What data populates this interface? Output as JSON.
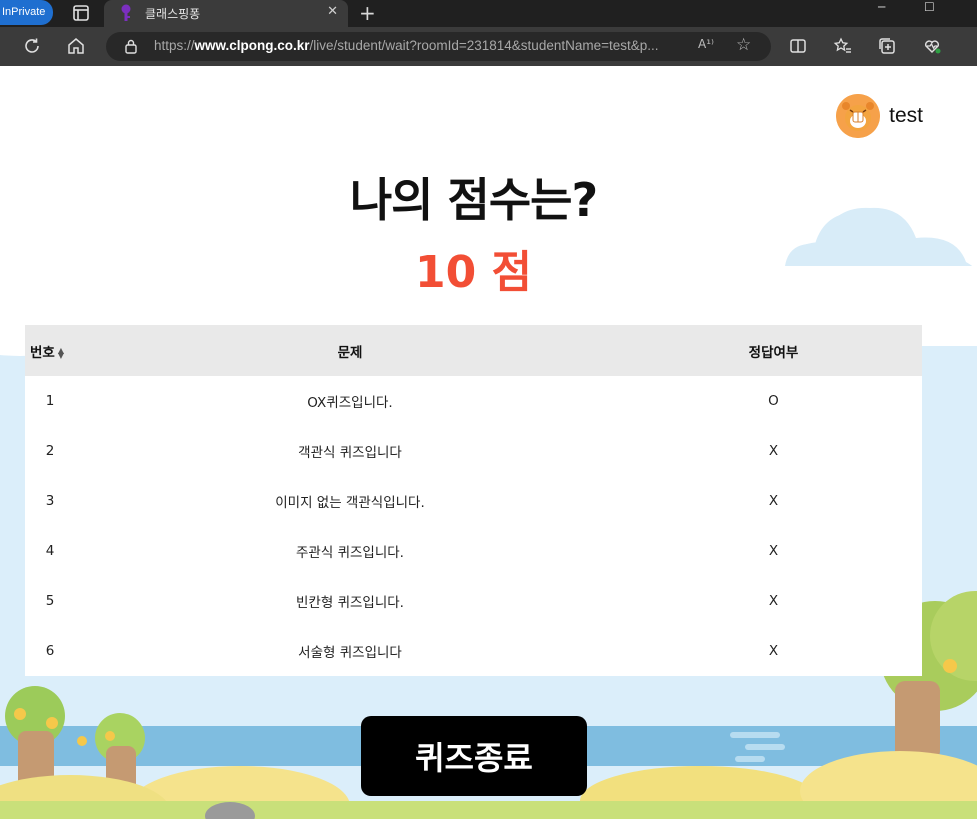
{
  "browser": {
    "inprivate_label": "InPrivate",
    "tab_title": "클래스핑퐁",
    "url_prefix": "https://",
    "url_domain": "www.clpong.co.kr",
    "url_rest": "/live/student/wait?roomId=231814&studentName=test&p...",
    "read_aloud": "A¹⁾",
    "icons": [
      "window-icon",
      "key-icon",
      "close-icon",
      "plus-icon",
      "minimize-icon",
      "maximize-icon",
      "refresh-icon",
      "home-icon",
      "lock-icon",
      "read-aloud-icon",
      "star-icon",
      "split-screen-icon",
      "favorites-icon",
      "collections-icon",
      "browser-essentials-icon"
    ]
  },
  "user": {
    "name": "test",
    "avatar_icon": "tiger-avatar-icon"
  },
  "result": {
    "heading": "나의 점수는?",
    "score": "10 점",
    "score_color": "#f24e35"
  },
  "table": {
    "headers": [
      "번호",
      "문제",
      "정답여부"
    ],
    "rows": [
      {
        "num": "1",
        "question": "OX퀴즈입니다.",
        "answer": "O"
      },
      {
        "num": "2",
        "question": "객관식 퀴즈입니다",
        "answer": "X"
      },
      {
        "num": "3",
        "question": "이미지 없는 객관식입니다.",
        "answer": "X"
      },
      {
        "num": "4",
        "question": "주관식 퀴즈입니다.",
        "answer": "X"
      },
      {
        "num": "5",
        "question": "빈칸형 퀴즈입니다.",
        "answer": "X"
      },
      {
        "num": "6",
        "question": "서술형 퀴즈입니다",
        "answer": "X"
      }
    ]
  },
  "actions": {
    "end_quiz_label": "퀴즈종료"
  }
}
